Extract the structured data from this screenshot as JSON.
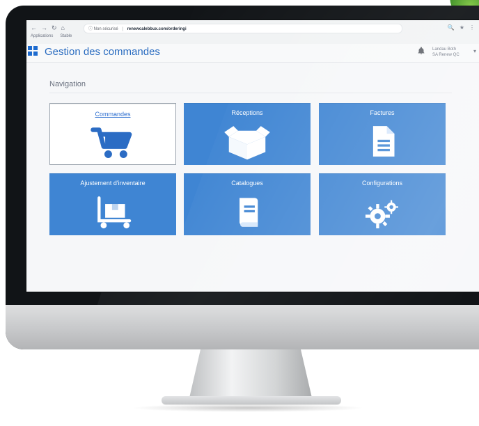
{
  "browser": {
    "nav_glyphs": [
      "←",
      "→",
      "↻",
      "⌂"
    ],
    "address_prefix": "ⓘ Non sécurisé",
    "address_url": "renewcalebbux.com/orderingi",
    "bookmark_items": [
      "Applications",
      "Stable"
    ],
    "right_glyphs": [
      "🔍",
      "★",
      "⋮"
    ]
  },
  "app": {
    "title": "Gestion des commandes",
    "user_line1": "Landau Both",
    "user_line2": "SA Renew QC",
    "user_caret": "▾"
  },
  "navigation": {
    "title": "Navigation",
    "tiles": [
      {
        "label": "Commandes",
        "icon": "cart-icon",
        "active": true
      },
      {
        "label": "Réceptions",
        "icon": "box-open-icon",
        "active": false
      },
      {
        "label": "Factures",
        "icon": "document-icon",
        "active": false
      },
      {
        "label": "Ajustement d'inventaire",
        "icon": "dolly-icon",
        "active": false
      },
      {
        "label": "Catalogues",
        "icon": "book-icon",
        "active": false
      },
      {
        "label": "Configurations",
        "icon": "gears-icon",
        "active": false
      }
    ]
  },
  "colors": {
    "primary_blue": "#3f85d3",
    "title_blue": "#2a6cc0",
    "active_link_blue": "#2e6fd0",
    "monitor_black": "#111417",
    "chin_silver": "#c7c8ca"
  }
}
